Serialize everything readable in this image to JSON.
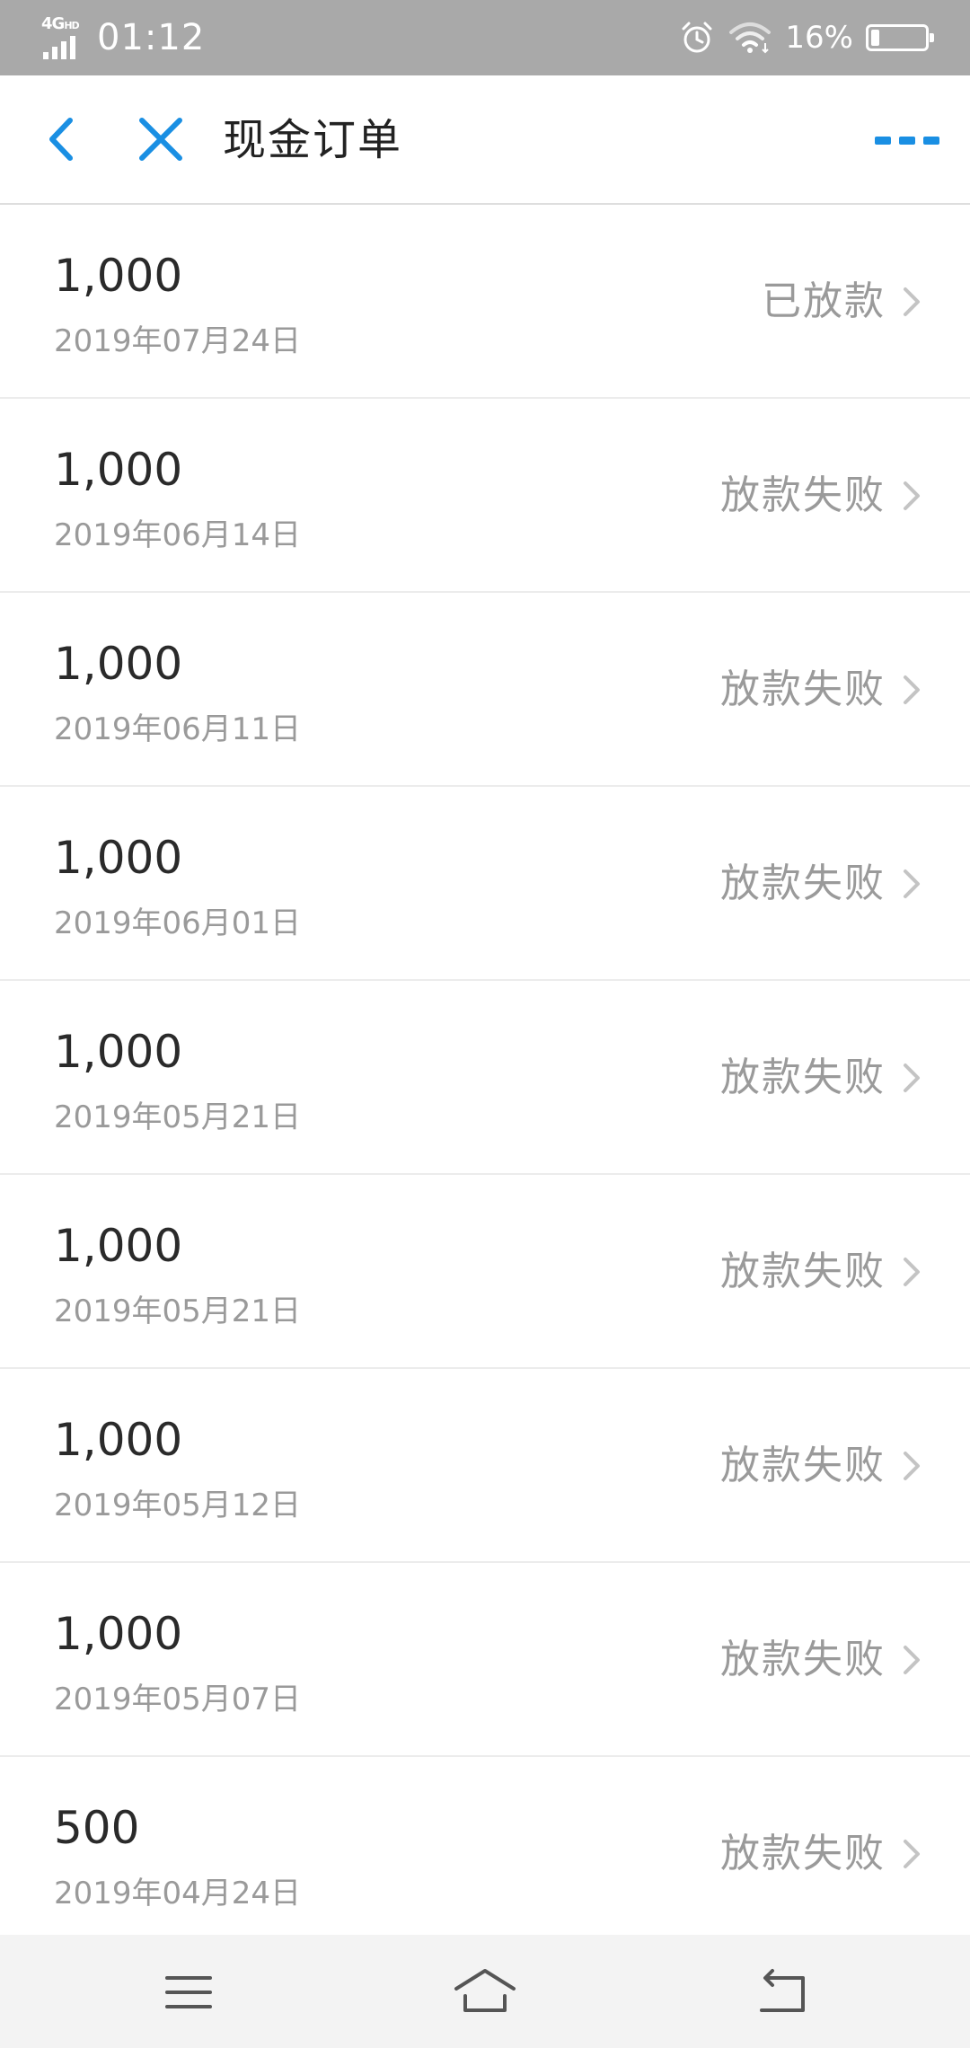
{
  "status_bar": {
    "network": "4G",
    "network_sub": "HD",
    "time": "01:12",
    "battery_percent_text": "16%",
    "battery_level": 0.16,
    "icons": [
      "signal-icon",
      "alarm-icon",
      "wifi-icon",
      "battery-icon"
    ]
  },
  "header": {
    "title": "现金订单",
    "back_icon": "chevron-left-icon",
    "close_icon": "close-icon",
    "more_icon": "more-dots-icon",
    "accent_color": "#1a8fe3"
  },
  "orders": [
    {
      "amount": "1,000",
      "date": "2019年07月24日",
      "status": "已放款"
    },
    {
      "amount": "1,000",
      "date": "2019年06月14日",
      "status": "放款失败"
    },
    {
      "amount": "1,000",
      "date": "2019年06月11日",
      "status": "放款失败"
    },
    {
      "amount": "1,000",
      "date": "2019年06月01日",
      "status": "放款失败"
    },
    {
      "amount": "1,000",
      "date": "2019年05月21日",
      "status": "放款失败"
    },
    {
      "amount": "1,000",
      "date": "2019年05月21日",
      "status": "放款失败"
    },
    {
      "amount": "1,000",
      "date": "2019年05月12日",
      "status": "放款失败"
    },
    {
      "amount": "1,000",
      "date": "2019年05月07日",
      "status": "放款失败"
    },
    {
      "amount": "500",
      "date": "2019年04月24日",
      "status": "放款失败"
    }
  ],
  "nav_bar": {
    "icons": [
      "menu-icon",
      "home-icon",
      "back-icon"
    ]
  }
}
